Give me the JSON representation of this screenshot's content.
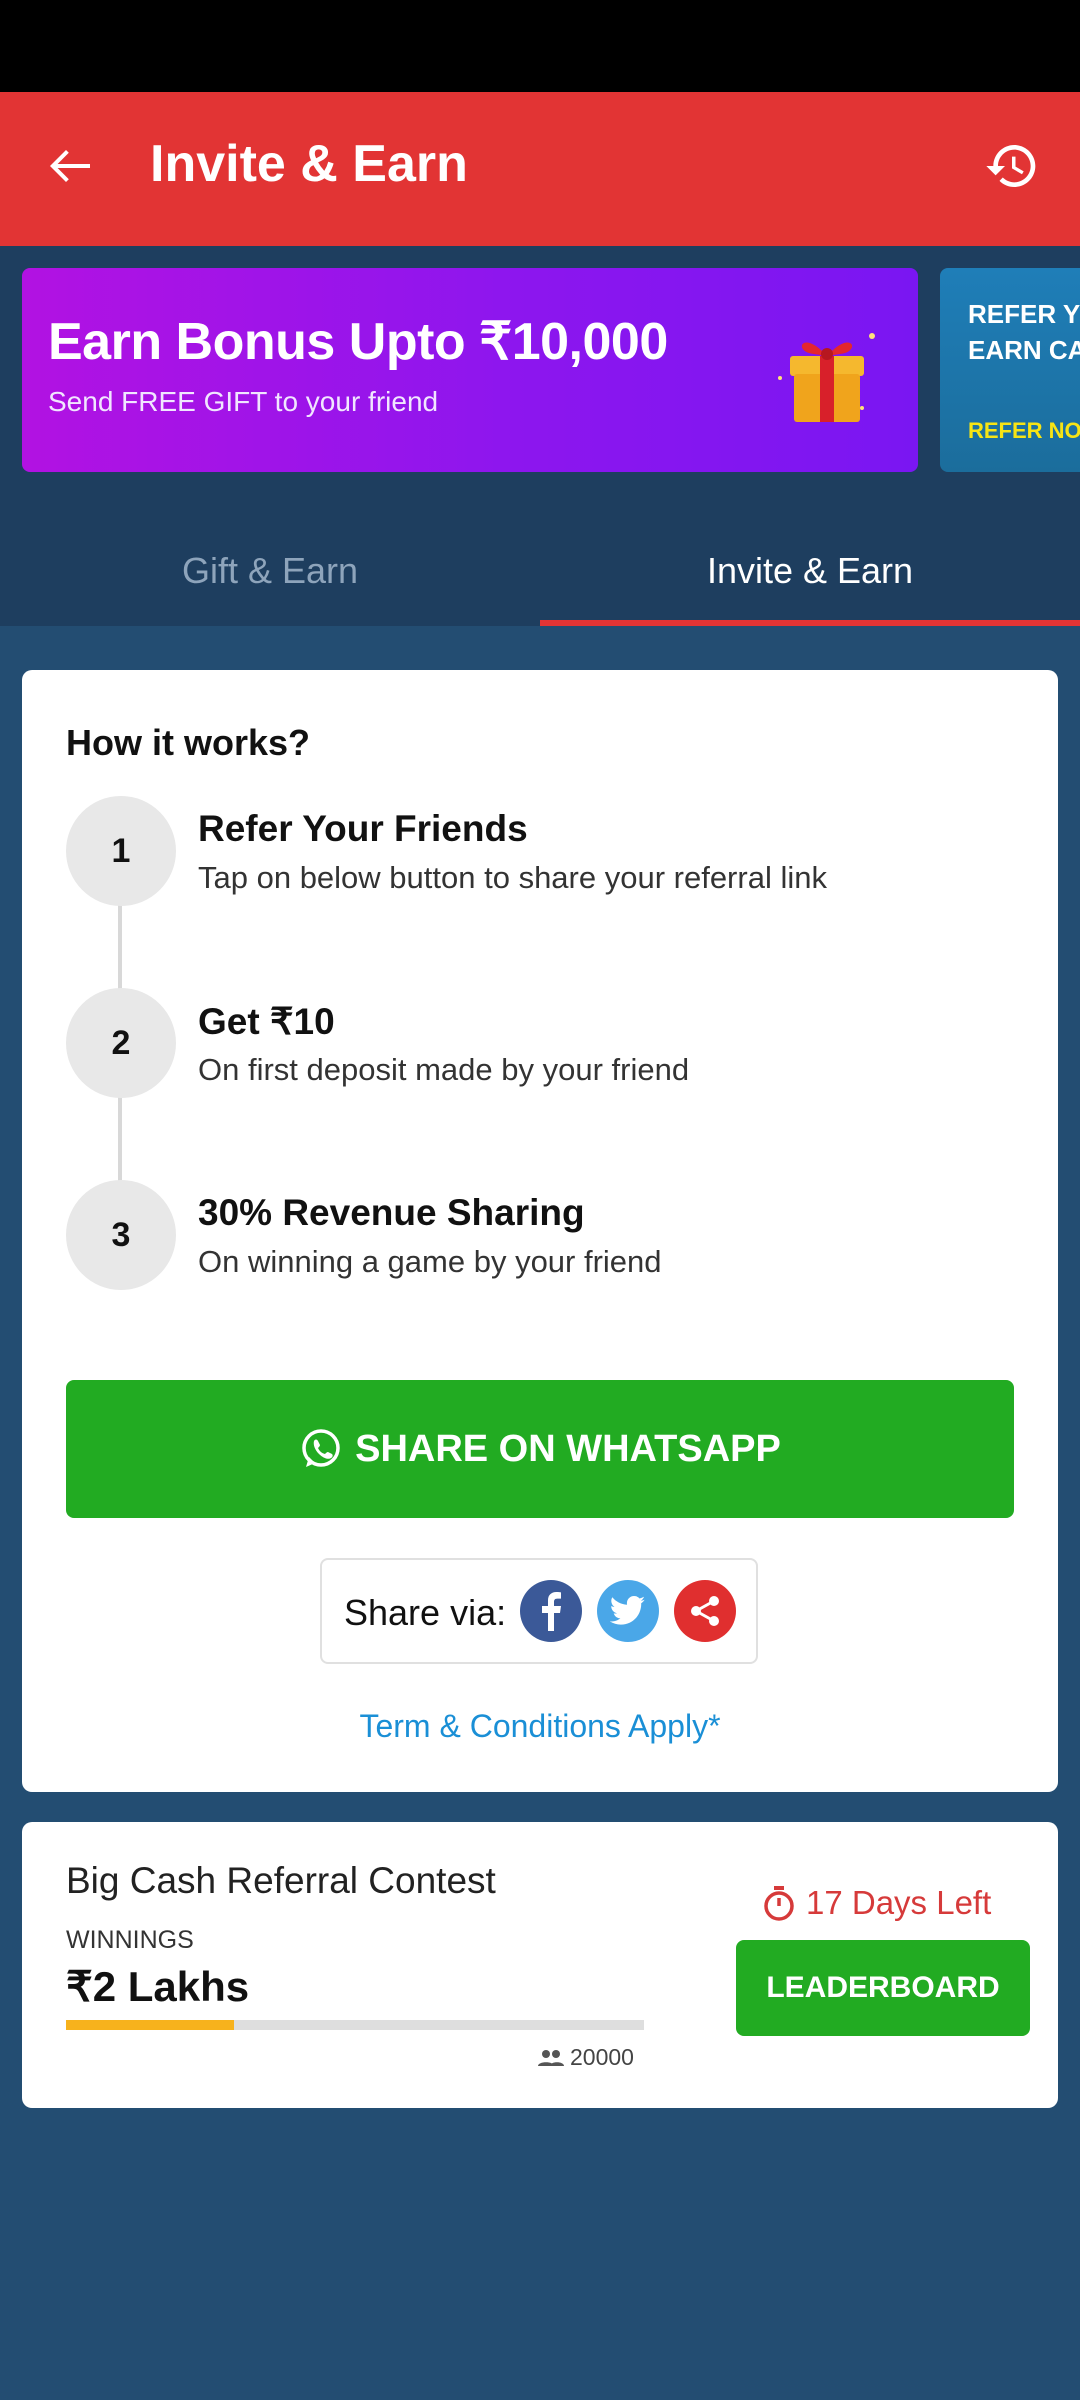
{
  "header": {
    "title": "Invite & Earn"
  },
  "banners": [
    {
      "headline": "Earn Bonus Upto ₹10,000",
      "subtext": "Send FREE GIFT to your friend"
    },
    {
      "line1": "REFER YO",
      "line2": "EARN CA",
      "cta": "REFER NOW"
    }
  ],
  "tabs": [
    {
      "label": "Gift & Earn",
      "active": false
    },
    {
      "label": "Invite & Earn",
      "active": true
    }
  ],
  "how_it_works": {
    "title": "How it works?",
    "steps": [
      {
        "number": "1",
        "title": "Refer Your Friends",
        "desc": "Tap on below button to share your referral link"
      },
      {
        "number": "2",
        "title": "Get ₹10",
        "desc": "On first deposit made by your friend"
      },
      {
        "number": "3",
        "title": "30% Revenue Sharing",
        "desc": "On winning a game by your friend"
      }
    ]
  },
  "share": {
    "whatsapp_label": "SHARE ON WHATSAPP",
    "share_via_label": "Share via:",
    "icons": [
      "facebook-icon",
      "twitter-icon",
      "share-icon"
    ]
  },
  "terms": "Term & Conditions Apply*",
  "contest": {
    "title": "Big Cash Referral Contest",
    "winnings_label": "WINNINGS",
    "amount": "₹2 Lakhs",
    "progress_fraction": 0.29,
    "participants": "20000",
    "days_left": "17 Days Left",
    "button": "LEADERBOARD"
  },
  "colors": {
    "primary_red": "#e23434",
    "whatsapp_green": "#22ab22",
    "background": "#234d72",
    "link_blue": "#1a8fd6",
    "progress": "#f7b21c"
  }
}
